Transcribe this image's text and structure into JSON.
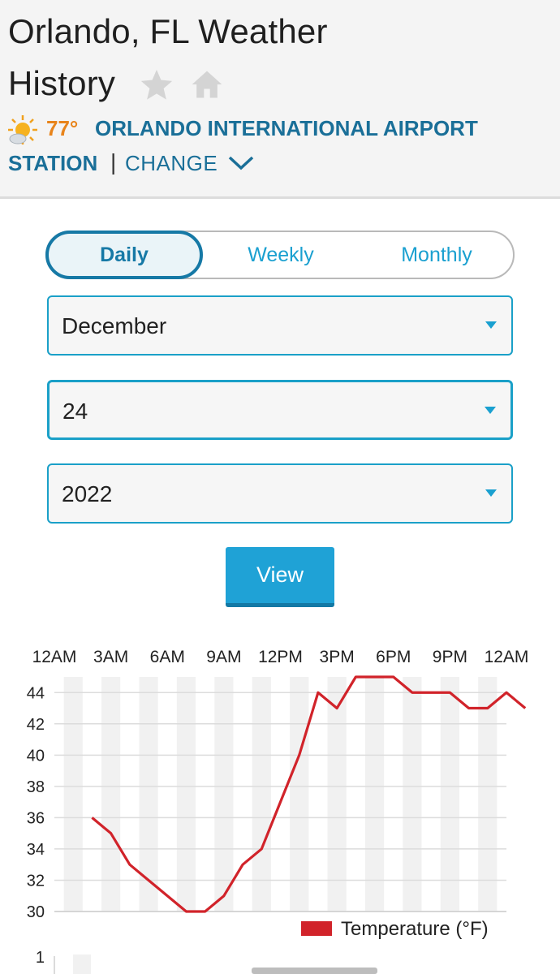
{
  "header": {
    "title_line1": "Orlando, FL Weather",
    "title_line2": "History",
    "current_temp": "77°",
    "station_line1": "ORLANDO INTERNATIONAL AIRPORT",
    "station_line2": "STATION",
    "separator": "|",
    "change_label": "CHANGE",
    "icons": [
      "star-icon",
      "home-icon",
      "sun-cloud-icon",
      "chevron-down-icon"
    ]
  },
  "period_tabs": {
    "daily": "Daily",
    "weekly": "Weekly",
    "monthly": "Monthly",
    "selected": "Daily"
  },
  "selectors": {
    "month": "December",
    "day": "24",
    "year": "2022"
  },
  "view_button": "View",
  "colors": {
    "accent": "#1fa2d6",
    "link": "#1a6f98",
    "temp_orange": "#e8841b",
    "series_red": "#d1232a"
  },
  "chart_data": {
    "type": "line",
    "x_tick_labels": [
      "12AM",
      "3AM",
      "6AM",
      "9AM",
      "12PM",
      "3PM",
      "6PM",
      "9PM",
      "12AM"
    ],
    "y_ticks": [
      30,
      32,
      34,
      36,
      38,
      40,
      42,
      44
    ],
    "ylim": [
      30,
      45
    ],
    "xlim_hours": [
      0,
      24
    ],
    "grid": true,
    "legend_position": "bottom-right",
    "series": [
      {
        "name": "Temperature (°F)",
        "color": "#d1232a",
        "x_hours": [
          2,
          3,
          4,
          5,
          6,
          7,
          8,
          9,
          10,
          11,
          12,
          13,
          14,
          15,
          16,
          17,
          18,
          19,
          20,
          21,
          22,
          23,
          24,
          25
        ],
        "values": [
          36,
          35,
          33,
          32,
          31,
          30,
          30,
          31,
          33,
          34,
          37,
          40,
          44,
          43,
          45,
          45,
          45,
          44,
          44,
          44,
          43,
          43,
          44,
          43
        ]
      }
    ],
    "second_chart_first_tick": "1"
  }
}
